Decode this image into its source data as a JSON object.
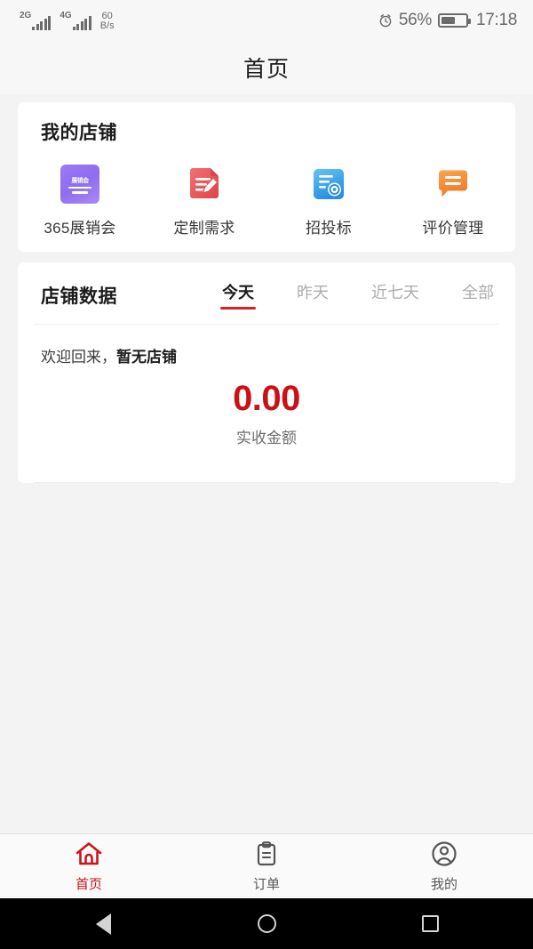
{
  "status_bar": {
    "signal_1_label": "2G",
    "signal_2_label": "4G",
    "net_speed_value": "60",
    "net_speed_unit": "B/s",
    "alarm_icon": "alarm-clock-icon",
    "battery_percent": "56%",
    "battery_level": 56,
    "time": "17:18"
  },
  "header": {
    "title": "首页"
  },
  "shop_card": {
    "title": "我的店铺",
    "items": [
      {
        "label": "365展销会",
        "icon": "expo-badge-icon",
        "icon_text": "展销会",
        "color": "#9579f0"
      },
      {
        "label": "定制需求",
        "icon": "document-pencil-icon",
        "color": "#e8585c"
      },
      {
        "label": "招投标",
        "icon": "document-target-icon",
        "color": "#3ba4ec"
      },
      {
        "label": "评价管理",
        "icon": "speech-bubble-icon",
        "color": "#f58a33"
      }
    ]
  },
  "data_card": {
    "title": "店铺数据",
    "tabs": [
      {
        "label": "今天",
        "active": true
      },
      {
        "label": "昨天",
        "active": false
      },
      {
        "label": "近七天",
        "active": false
      },
      {
        "label": "全部",
        "active": false
      }
    ],
    "welcome_prefix": "欢迎回来，",
    "shop_name": "暂无店铺",
    "stat_value": "0.00",
    "stat_caption": "实收金额",
    "accent_color": "#cb1118"
  },
  "tab_bar": {
    "items": [
      {
        "label": "首页",
        "icon": "home-icon",
        "active": true
      },
      {
        "label": "订单",
        "icon": "clipboard-icon",
        "active": false
      },
      {
        "label": "我的",
        "icon": "user-circle-icon",
        "active": false
      }
    ],
    "active_color": "#c8161d"
  },
  "android_nav": {
    "back": "back-triangle-icon",
    "home": "home-circle-icon",
    "recents": "recents-square-icon"
  }
}
